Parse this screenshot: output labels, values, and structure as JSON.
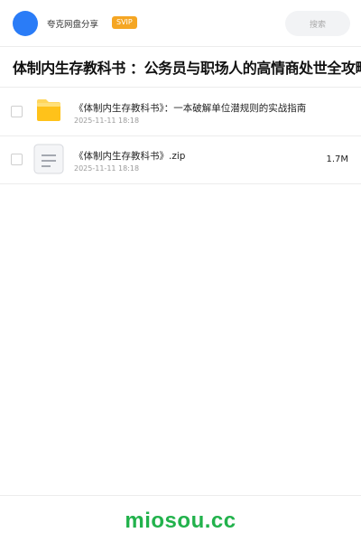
{
  "header": {
    "user_name": "夸克网盘分享",
    "badge": "SVIP",
    "search_placeholder": "搜索"
  },
  "page": {
    "title": "体制内生存教科书 ：公务员与职场人的高情商处世全攻略"
  },
  "files": [
    {
      "name": "《体制内生存教科书》：一本破解单位潜规则的实战指南",
      "date": "2025-11-11 18:18",
      "size": "",
      "type": "folder",
      "icon": "folder-icon"
    },
    {
      "name": "《体制内生存教科书》.zip",
      "date": "2025-11-11 18:18",
      "size": "1.7M",
      "type": "file",
      "icon": "document-icon"
    }
  ],
  "footer": {
    "brand": "miosou.cc"
  },
  "colors": {
    "avatar": "#2a7cf7",
    "badge": "#f5a623",
    "folder": "#ffc21a",
    "brand": "#22b24c"
  }
}
